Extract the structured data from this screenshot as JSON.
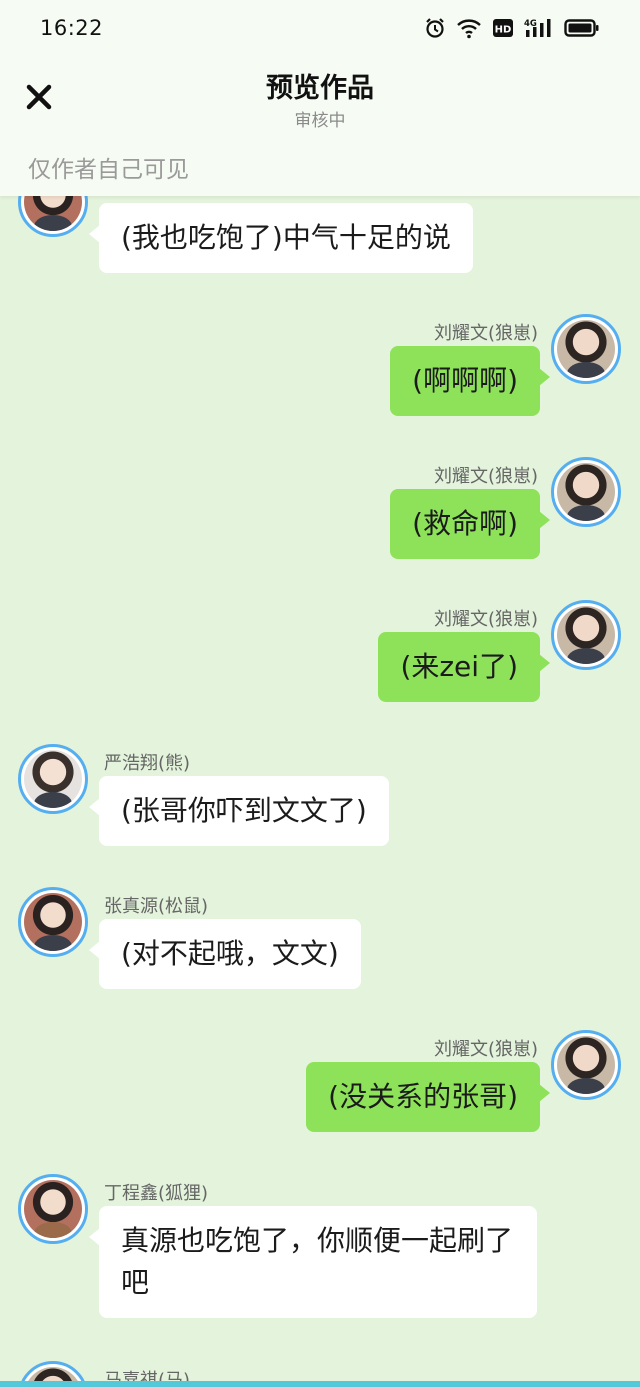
{
  "status_bar": {
    "time": "16:22",
    "icons": [
      "alarm-icon",
      "wifi-icon",
      "hd-icon",
      "4g-signal-icon",
      "battery-icon"
    ],
    "hd_label": "HD",
    "network_label": "4G"
  },
  "header": {
    "title": "预览作品",
    "subtitle": "审核中",
    "close_icon": "close-icon"
  },
  "notice": "仅作者自己可见",
  "colors": {
    "background": "#e4f4dc",
    "bubble_left": "#ffffff",
    "bubble_right": "#8ee25a",
    "avatar_ring": "#55aef0"
  },
  "messages": [
    {
      "side": "left",
      "name": "",
      "text": "(我也吃饱了)中气十足的说"
    },
    {
      "side": "right",
      "name": "刘耀文(狼崽)",
      "text": "(啊啊啊)"
    },
    {
      "side": "right",
      "name": "刘耀文(狼崽)",
      "text": "(救命啊)"
    },
    {
      "side": "right",
      "name": "刘耀文(狼崽)",
      "text": "(来zei了)"
    },
    {
      "side": "left",
      "name": "严浩翔(熊)",
      "text": "(张哥你吓到文文了)"
    },
    {
      "side": "left",
      "name": "张真源(松鼠)",
      "text": "(对不起哦，文文)"
    },
    {
      "side": "right",
      "name": "刘耀文(狼崽)",
      "text": "(没关系的张哥)"
    },
    {
      "side": "left",
      "name": "丁程鑫(狐狸)",
      "text": "真源也吃饱了，你顺便一起刷了吧"
    },
    {
      "side": "left",
      "name": "马嘉祺(马)",
      "text": ""
    }
  ]
}
